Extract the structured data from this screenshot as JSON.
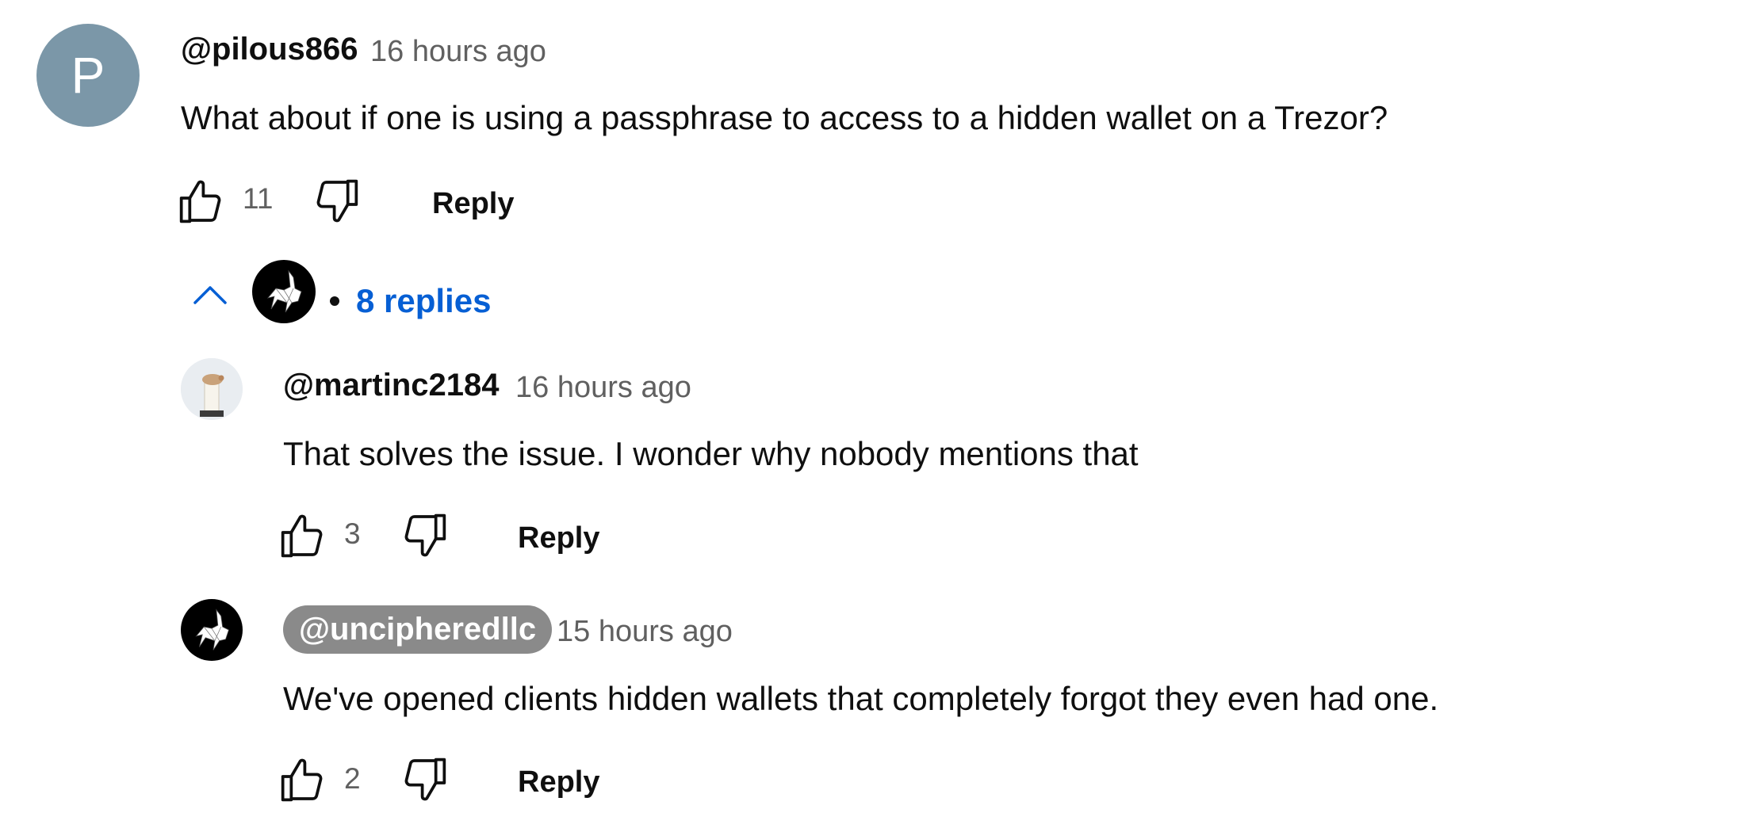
{
  "comment": {
    "avatar_letter": "P",
    "author": "@pilous866",
    "time": "16 hours ago",
    "text": "What about if one is using a passphrase to access to a hidden wallet on a Trezor?",
    "likes": "11",
    "reply_label": "Reply"
  },
  "replies_toggle": {
    "label": "8 replies",
    "icon": "chevron-up-icon"
  },
  "replies": [
    {
      "author": "@martinc2184",
      "time": "16 hours ago",
      "text": "That solves the issue. I wonder why nobody mentions that",
      "likes": "3",
      "reply_label": "Reply"
    },
    {
      "author": "@uncipheredllc",
      "time": "15 hours ago",
      "text": "We've opened clients hidden wallets that completely forgot they even had one.",
      "likes": "2",
      "reply_label": "Reply"
    }
  ],
  "colors": {
    "link": "#065fd4",
    "secondary_text": "#606060",
    "owner_badge": "#8a8a8a",
    "avatar_bg": "#7b97a8"
  }
}
